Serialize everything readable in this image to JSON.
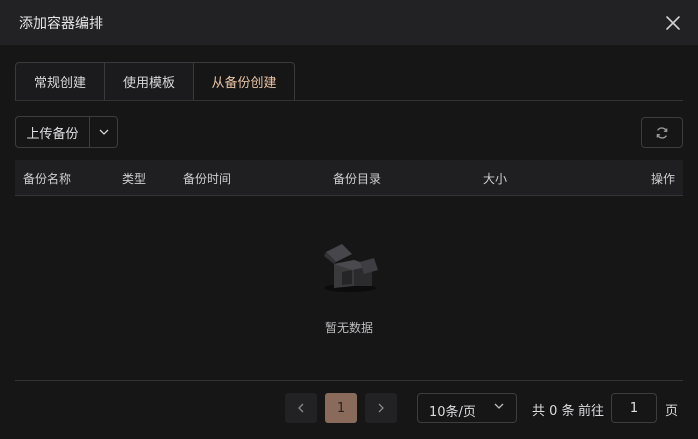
{
  "dialog": {
    "title": "添加容器编排"
  },
  "icons": {
    "close": "close-icon",
    "dropdown": "chevron-down-icon",
    "refresh": "refresh-icon",
    "empty": "empty-box-icon"
  },
  "tabs": [
    {
      "label": "常规创建",
      "active": false
    },
    {
      "label": "使用模板",
      "active": false
    },
    {
      "label": "从备份创建",
      "active": true
    }
  ],
  "toolbar": {
    "upload_label": "上传备份"
  },
  "table": {
    "columns": [
      "备份名称",
      "类型",
      "备份时间",
      "备份目录",
      "大小",
      "操作"
    ],
    "rows": [],
    "empty_text": "暂无数据"
  },
  "pagination": {
    "current_page": "1",
    "page_size": "10条/页",
    "total": "共 0 条",
    "goto_label": "前往",
    "goto_value": "1",
    "goto_suffix": "页"
  },
  "colors": {
    "accent": "#e8c3a3",
    "active_page": "#8a6a5a",
    "background": "#161617"
  }
}
